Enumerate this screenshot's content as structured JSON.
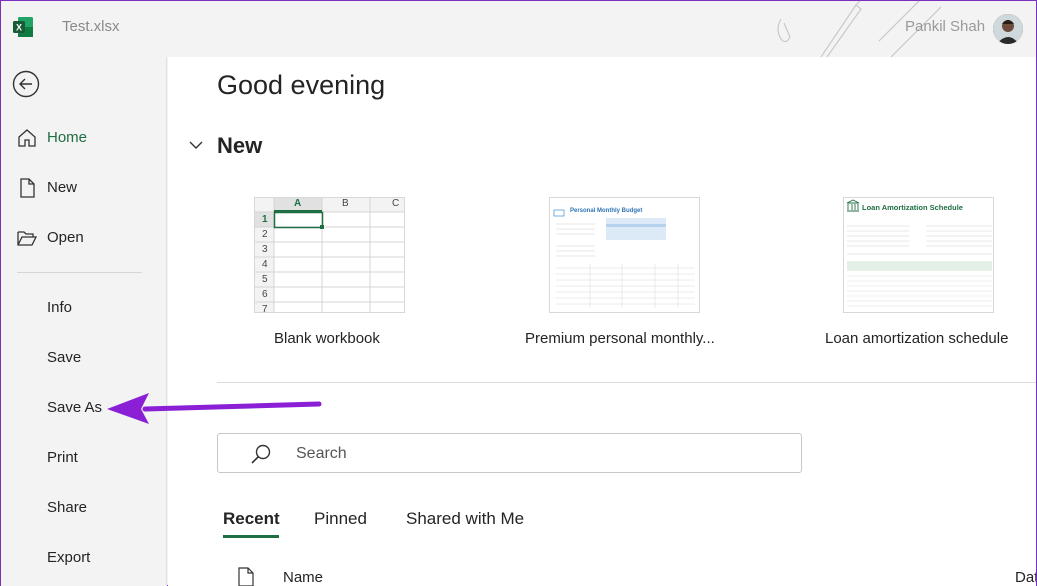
{
  "titlebar": {
    "doc_title": "Test.xlsx",
    "user_name": "Pankil Shah"
  },
  "sidebar": {
    "items": [
      {
        "label": "Home",
        "icon": "home-icon"
      },
      {
        "label": "New",
        "icon": "new-file-icon"
      },
      {
        "label": "Open",
        "icon": "folder-open-icon"
      },
      {
        "label": "Info"
      },
      {
        "label": "Save"
      },
      {
        "label": "Save As"
      },
      {
        "label": "Print"
      },
      {
        "label": "Share"
      },
      {
        "label": "Export"
      }
    ]
  },
  "main": {
    "greeting": "Good evening",
    "new_section_title": "New",
    "templates": [
      {
        "label": "Blank workbook"
      },
      {
        "label": "Premium personal monthly..."
      },
      {
        "label": "Loan amortization schedule"
      }
    ],
    "blank_grid": {
      "columns": [
        "A",
        "B",
        "C"
      ],
      "rows": [
        "1",
        "2",
        "3",
        "4",
        "5",
        "6",
        "7"
      ]
    },
    "budget_thumb_title": "Personal Monthly Budget",
    "loan_thumb_title": "Loan Amortization Schedule",
    "search": {
      "placeholder": "Search"
    },
    "tabs": [
      "Recent",
      "Pinned",
      "Shared with Me"
    ],
    "columns": {
      "name": "Name",
      "date": "Date modified"
    }
  },
  "colors": {
    "accent_green": "#1f6e43",
    "annotation_purple": "#8a1fd6",
    "excel_green": "#107c41"
  }
}
